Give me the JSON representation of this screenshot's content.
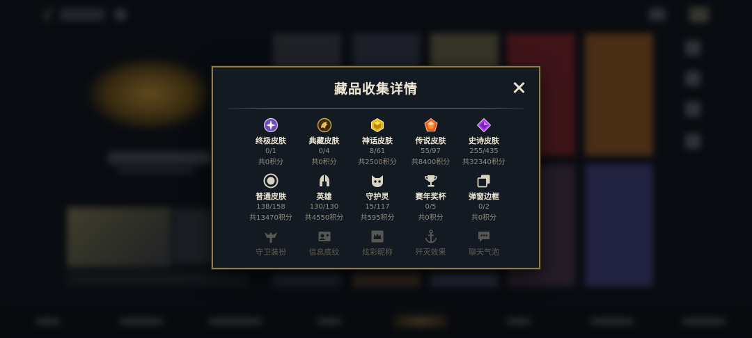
{
  "modal": {
    "title": "藏品收集详情",
    "close_icon": "close-icon",
    "rows": [
      [
        {
          "icon": "ultimate-skin-icon",
          "label": "终极皮肤",
          "count": "0/1",
          "points": "共0积分",
          "color": "#b89be8"
        },
        {
          "icon": "prestige-skin-icon",
          "label": "典藏皮肤",
          "count": "0/4",
          "points": "共0积分",
          "color": "#d4a53c"
        },
        {
          "icon": "mythic-skin-icon",
          "label": "神话皮肤",
          "count": "8/61",
          "points": "共2500积分",
          "color": "#e8b820"
        },
        {
          "icon": "legendary-skin-icon",
          "label": "传说皮肤",
          "count": "55/97",
          "points": "共8400积分",
          "color": "#e85d1e"
        },
        {
          "icon": "epic-skin-icon",
          "label": "史诗皮肤",
          "count": "255/435",
          "points": "共32340积分",
          "color": "#a93ce6"
        }
      ],
      [
        {
          "icon": "common-skin-icon",
          "label": "普通皮肤",
          "count": "138/158",
          "points": "共13470积分",
          "color": "#d8d2c2"
        },
        {
          "icon": "champion-helmet-icon",
          "label": "英雄",
          "count": "130/130",
          "points": "共4550积分",
          "color": "#d8d2c2"
        },
        {
          "icon": "guardian-icon",
          "label": "守护灵",
          "count": "15/117",
          "points": "共595积分",
          "color": "#d8d2c2"
        },
        {
          "icon": "trophy-icon",
          "label": "赛年奖杯",
          "count": "0/5",
          "points": "共0积分",
          "color": "#d8d2c2"
        },
        {
          "icon": "frame-icon",
          "label": "弹窗边框",
          "count": "0/2",
          "points": "共0积分",
          "color": "#d8d2c2"
        }
      ],
      [
        {
          "icon": "guardian-attire-icon",
          "label": "守卫装扮",
          "color": "#8e8a80"
        },
        {
          "icon": "profile-banner-icon",
          "label": "信息底纹",
          "color": "#8e8a80"
        },
        {
          "icon": "title-crown-icon",
          "label": "炫彩昵称",
          "color": "#8e8a80"
        },
        {
          "icon": "anchor-icon",
          "label": "歼灭效果",
          "color": "#8e8a80"
        },
        {
          "icon": "chat-bubble-icon",
          "label": "聊天气泡",
          "color": "#8e8a80"
        }
      ]
    ]
  }
}
